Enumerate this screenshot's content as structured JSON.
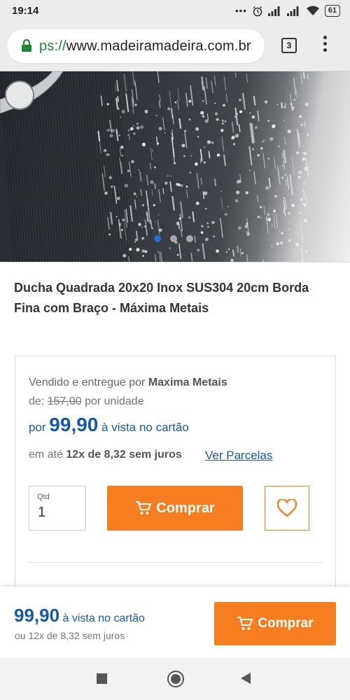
{
  "status_bar": {
    "time": "19:14",
    "dots": "•••",
    "battery": "61",
    "icons": [
      "alarm-icon",
      "signal-icon",
      "signal-icon",
      "wifi-icon",
      "battery-icon"
    ]
  },
  "browser": {
    "url_scheme": "ps://",
    "url_host": "www.madeiramadeira.com.br",
    "tab_count": "3",
    "icons": [
      "lock-icon",
      "menu-icon"
    ]
  },
  "hero": {
    "slide_count": 3,
    "active_slide": 1
  },
  "product": {
    "title": "Ducha Quadrada 20x20 Inox SUS304 20cm Borda Fina com Braço - Máxima Metais"
  },
  "offer": {
    "sold_by_prefix": "Vendido e entregue por ",
    "seller": "Maxima Metais",
    "old_price_prefix": "de: ",
    "old_price": "157,00",
    "old_price_suffix": " por unidade",
    "price_prefix": "por ",
    "price": "99,90",
    "price_suffix": " à vista no cartão",
    "installments_prefix": "em até ",
    "installments": "12x de 8,32 sem juros",
    "installments_link": "Ver Parcelas",
    "qty_label": "Qtd",
    "qty_value": "1",
    "buy_label": "Comprar",
    "icons": [
      "cart-icon",
      "heart-icon"
    ]
  },
  "sticky": {
    "price": "99,90",
    "price_suffix": " à vista no cartão",
    "installments": "ou 12x de 8,32 sem juros",
    "buy_label": "Comprar"
  },
  "colors": {
    "accent_orange": "#f57f20",
    "price_blue": "#1759a5",
    "dot_active": "#1f6fd1"
  }
}
